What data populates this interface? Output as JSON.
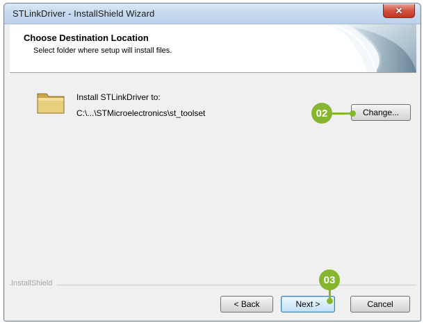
{
  "window": {
    "title": "STLinkDriver - InstallShield Wizard",
    "close_label": "✕"
  },
  "header": {
    "title": "Choose Destination Location",
    "subtitle": "Select folder where setup will install files."
  },
  "content": {
    "install_label": "Install STLinkDriver to:",
    "install_path": "C:\\...\\STMicroelectronics\\st_toolset",
    "change_button": "Change..."
  },
  "footer": {
    "brand": "InstallShield",
    "back_button": "< Back",
    "next_button": "Next >",
    "cancel_button": "Cancel"
  },
  "annotations": {
    "step_change": "02",
    "step_next": "03"
  },
  "colors": {
    "annotation": "#86b52f",
    "title_bar": "#c4d8ee",
    "close_button": "#d0533f"
  },
  "icons": {
    "folder": "folder-icon",
    "header_art": "installshield-art-icon",
    "close": "close-icon"
  }
}
